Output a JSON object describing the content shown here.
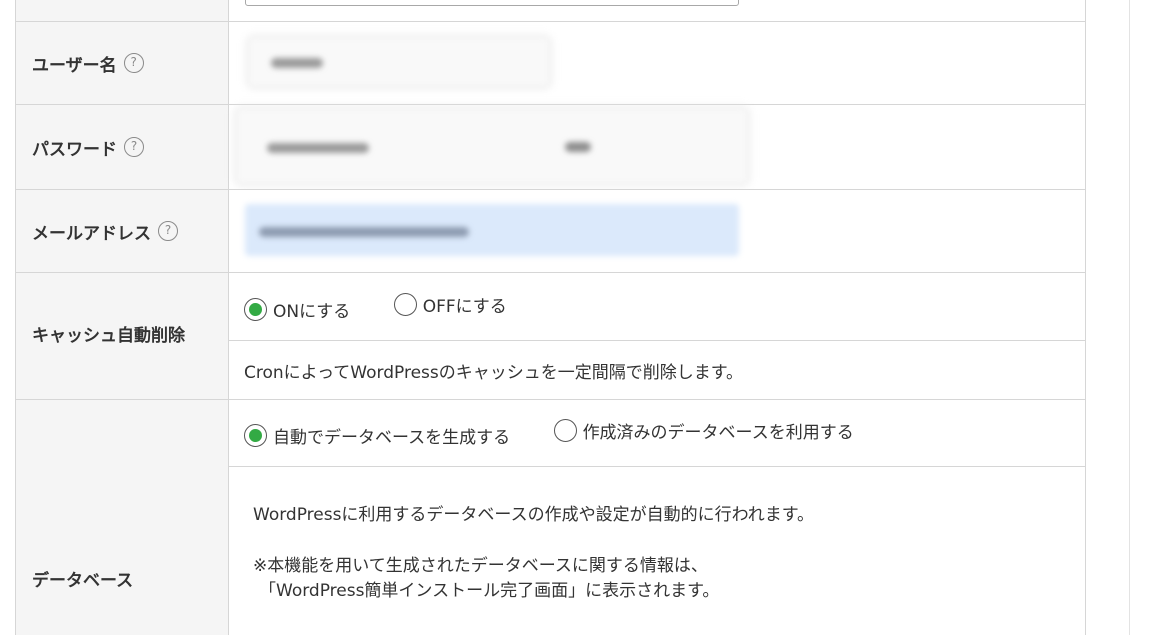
{
  "form": {
    "username": {
      "label": "ユーザー名",
      "help": "?"
    },
    "password": {
      "label": "パスワード",
      "help": "?"
    },
    "email": {
      "label": "メールアドレス",
      "help": "?"
    },
    "cache": {
      "label": "キャッシュ自動削除",
      "option_on": "ONにする",
      "option_off": "OFFにする",
      "selected": "on",
      "description": "CronによってWordPressのキャッシュを一定間隔で削除します。"
    },
    "database": {
      "label": "データベース",
      "option_auto": "自動でデータベースを生成する",
      "option_existing": "作成済みのデータベースを利用する",
      "selected": "auto",
      "description_1": "WordPressに利用するデータベースの作成や設定が自動的に行われます。",
      "description_2": "※本機能を用いて生成されたデータベースに関する情報は、",
      "description_3": "「WordPress簡単インストール完了画面」に表示されます。"
    }
  },
  "colors": {
    "header_bg": "#f5f5f5",
    "border": "#d6d6d6",
    "radio_checked": "#33aa44",
    "email_field_bg": "#dbe9fb"
  },
  "icons": {
    "help": "question-circle-icon",
    "radio": "radio-button"
  }
}
